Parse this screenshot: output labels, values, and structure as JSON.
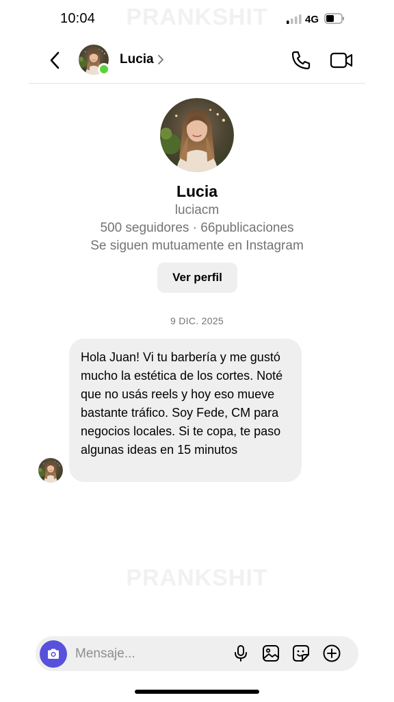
{
  "status_bar": {
    "time": "10:04",
    "network": "4G",
    "watermark": "PRANKSHIT"
  },
  "header": {
    "name": "Lucia",
    "online": true,
    "online_color": "#5bd33d",
    "icons": [
      "chevron-left-icon",
      "phone-icon",
      "video-camera-icon"
    ]
  },
  "profile": {
    "name": "Lucia",
    "username": "luciacm",
    "stats": "500 seguidores · 66publicaciones",
    "mutual": "Se siguen mutuamente en Instagram",
    "view_profile_label": "Ver perfil"
  },
  "chat": {
    "date": "9 DIC. 2025",
    "messages": [
      {
        "sender": "Lucia",
        "text": "Hola Juan! Vi tu barbería y me gustó mucho la estética de los cortes. Noté que no usás reels y hoy eso mueve bastante tráfico. Soy Fede, CM para negocios locales. Si te copa, te paso algunas ideas en 15 minutos"
      }
    ]
  },
  "composer": {
    "placeholder": "Mensaje...",
    "camera_color": "#5851db",
    "icons": [
      "camera-icon",
      "microphone-icon",
      "gallery-icon",
      "sticker-icon",
      "plus-circle-icon"
    ]
  },
  "watermark_mid": "PRANKSHIT"
}
